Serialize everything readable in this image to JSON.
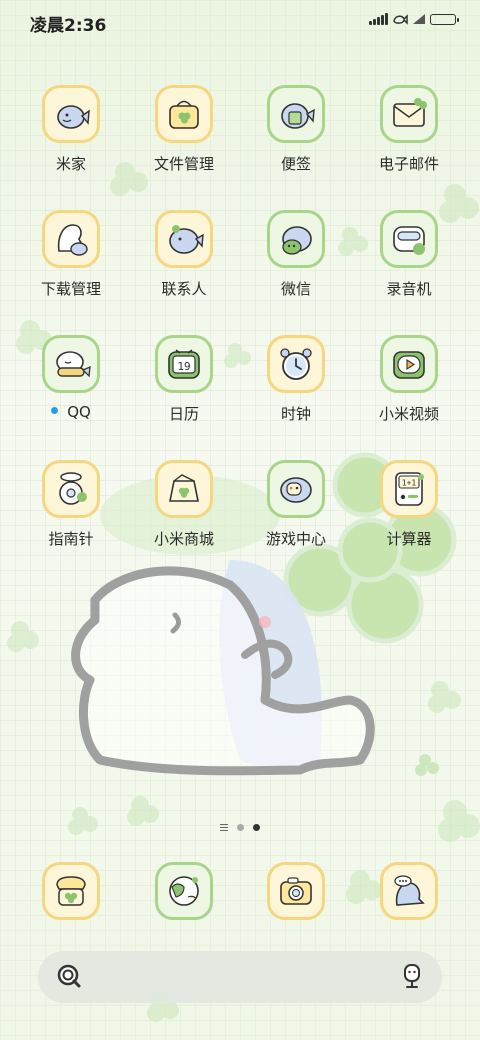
{
  "status_bar": {
    "time": "凌晨2:36"
  },
  "apps": [
    {
      "label": "米家",
      "style": "yellow",
      "icon": "fish-mascot-icon"
    },
    {
      "label": "文件管理",
      "style": "yellow",
      "icon": "clover-bag-icon"
    },
    {
      "label": "便签",
      "style": "green",
      "icon": "fish-note-icon"
    },
    {
      "label": "电子邮件",
      "style": "green",
      "icon": "mail-clover-icon"
    },
    {
      "label": "下载管理",
      "style": "yellow",
      "icon": "download-ghost-icon"
    },
    {
      "label": "联系人",
      "style": "yellow",
      "icon": "fish-contact-icon"
    },
    {
      "label": "微信",
      "style": "green",
      "icon": "fish-chat-icon"
    },
    {
      "label": "录音机",
      "style": "green",
      "icon": "recorder-icon"
    },
    {
      "label": "QQ",
      "style": "green",
      "icon": "fish-scarf-icon",
      "badge": true
    },
    {
      "label": "日历",
      "style": "green",
      "icon": "calendar-tv-icon",
      "day": "19"
    },
    {
      "label": "时钟",
      "style": "yellow",
      "icon": "alarm-clock-icon"
    },
    {
      "label": "小米视频",
      "style": "green",
      "icon": "video-tv-icon"
    },
    {
      "label": "指南针",
      "style": "yellow",
      "icon": "compass-scale-icon"
    },
    {
      "label": "小米商城",
      "style": "yellow",
      "icon": "shop-bag-icon"
    },
    {
      "label": "游戏中心",
      "style": "green",
      "icon": "fish-game-icon"
    },
    {
      "label": "计算器",
      "style": "yellow",
      "icon": "calculator-icon",
      "display": "1+1"
    }
  ],
  "dock": [
    {
      "style": "yellow",
      "icon": "phone-clover-icon"
    },
    {
      "style": "green",
      "icon": "browser-globe-icon"
    },
    {
      "style": "yellow",
      "icon": "camera-icon"
    },
    {
      "style": "yellow",
      "icon": "message-ghost-icon"
    }
  ],
  "colors": {
    "yellow_border": "#f5d77f",
    "green_border": "#a9d58a",
    "badge": "#2a9cf0"
  }
}
